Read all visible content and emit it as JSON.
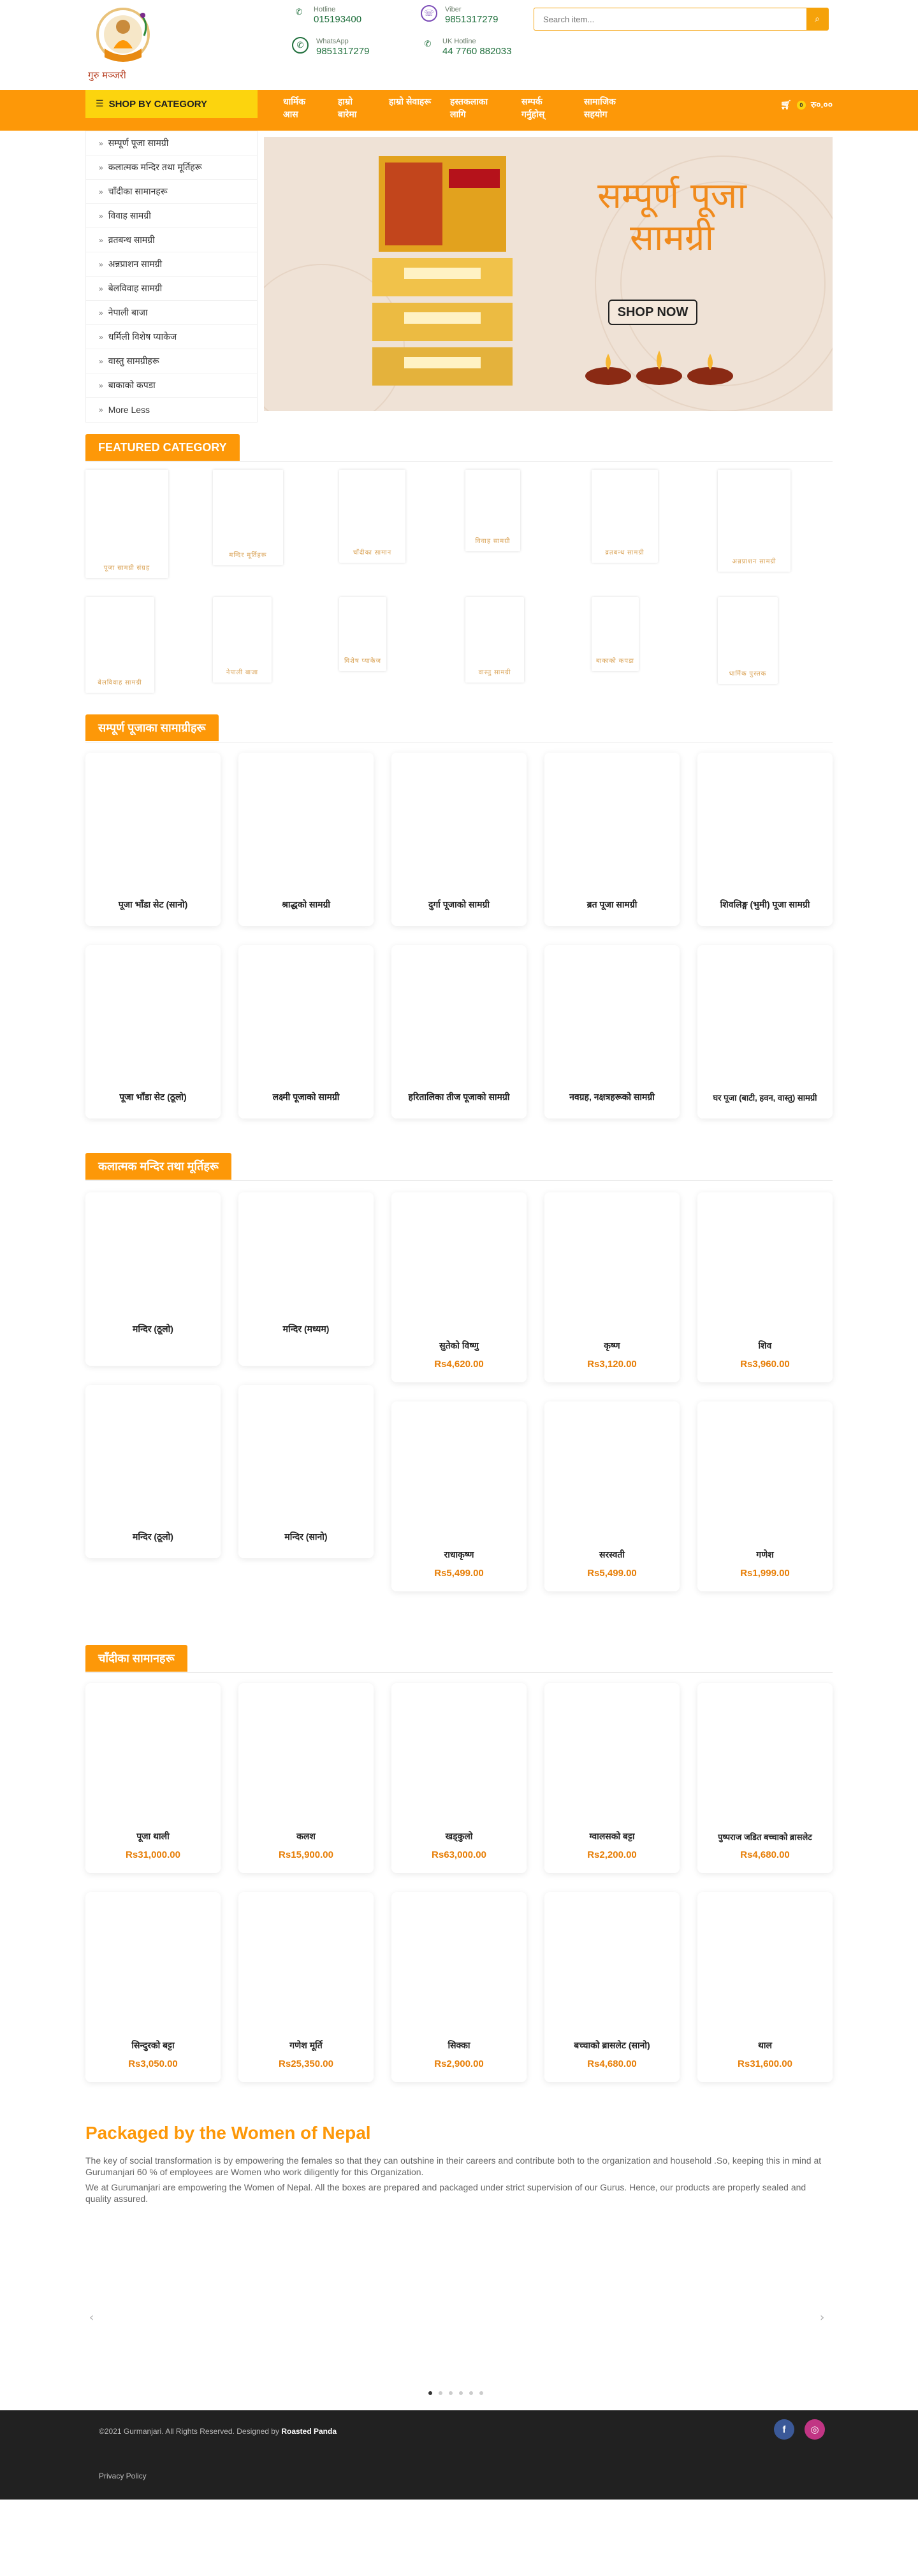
{
  "header": {
    "brand_name": "गुरु मञ्जरी",
    "hotlines": [
      {
        "label": "Hotline",
        "number": "015193400",
        "icon": "phone-icon"
      },
      {
        "label": "Viber",
        "number": "9851317279",
        "icon": "viber-icon"
      },
      {
        "label": "WhatsApp",
        "number": "9851317279",
        "icon": "whatsapp-icon"
      },
      {
        "label": "UK Hotline",
        "number": "44 7760 882033",
        "icon": "phone-icon"
      }
    ],
    "search_placeholder": "Search item..."
  },
  "nav": {
    "category_button": "SHOP BY CATEGORY",
    "items": [
      "धार्मिक आस",
      "हाम्रो बारेमा",
      "हाम्रो सेवाहरू",
      "हस्तकलाका लागि",
      "सम्पर्क गर्नुहोस्",
      "सामाजिक सहयोग"
    ],
    "cart_count": "0",
    "cart_total": "रु०.००"
  },
  "sidebar": {
    "items": [
      "सम्पूर्ण पूजा सामग्री",
      "कलात्मक मन्दिर तथा मूर्तिहरू",
      "चाँदीका सामानहरू",
      "विवाह सामग्री",
      "व्रतबन्ध सामग्री",
      "अन्नप्राशन सामग्री",
      "बेलविवाह सामग्री",
      "नेपाली बाजा",
      "धर्मिली विशेष प्याकेज",
      "वास्तु सामग्रीहरू",
      "बाकाको कपडा",
      "More Less"
    ]
  },
  "banner": {
    "title_line1": "सम्पूर्ण पूजा",
    "title_line2": "सामग्री",
    "shop_button": "SHOP NOW"
  },
  "featured": {
    "heading": "FEATURED CATEGORY",
    "labels": [
      "पूजा सामग्री संग्रह",
      "मन्दिर मूर्तिहरू",
      "चाँदीका सामान",
      "विवाह सामग्री",
      "व्रतबन्ध सामग्री",
      "अन्नप्राशन सामग्री",
      "बेलविवाह सामग्री",
      "नेपाली बाजा",
      "विशेष प्याकेज",
      "वास्तु सामग्री",
      "बाकाको कपडा",
      "धार्मिक पुस्तक"
    ]
  },
  "puja_section": {
    "heading": "सम्पूर्ण पूजाका सामाग्रीहरू",
    "items": [
      "पूजा भाँडा सेट (सानो)",
      "श्राद्धको सामग्री",
      "दुर्गा पूजाको सामग्री",
      "ब्रत पूजा सामग्री",
      "शिवलिङ्ग (भुमी) पूजा सामग्री",
      "पूजा भाँडा सेट (ठूलो)",
      "लक्ष्मी पूजाको सामग्री",
      "हरितालिका तीज पूजाको सामग्री",
      "नवग्रह, नक्षत्रहरूको सामग्री",
      "घर पूजा (बाटी, हवन, वास्तु) सामग्री"
    ]
  },
  "temple_section": {
    "heading": "कलात्मक मन्दिर तथा मूर्तिहरू",
    "items": [
      {
        "name": "मन्दिर (ठूलो)",
        "price": ""
      },
      {
        "name": "मन्दिर (मध्यम)",
        "price": ""
      },
      {
        "name": "सुतेको विष्णु",
        "price": "Rs4,620.00"
      },
      {
        "name": "कृष्ण",
        "price": "Rs3,120.00"
      },
      {
        "name": "शिव",
        "price": "Rs3,960.00"
      },
      {
        "name": "मन्दिर (ठूलो)",
        "price": ""
      },
      {
        "name": "मन्दिर (सानो)",
        "price": ""
      },
      {
        "name": "राधाकृष्ण",
        "price": "Rs5,499.00"
      },
      {
        "name": "सरस्वती",
        "price": "Rs5,499.00"
      },
      {
        "name": "गणेश",
        "price": "Rs1,999.00"
      }
    ]
  },
  "silver_section": {
    "heading": "चाँदीका सामानहरू",
    "items": [
      {
        "name": "पूजा थाली",
        "price": "Rs31,000.00"
      },
      {
        "name": "कलश",
        "price": "Rs15,900.00"
      },
      {
        "name": "खड्कुलो",
        "price": "Rs63,000.00"
      },
      {
        "name": "ग्वालसको बट्टा",
        "price": "Rs2,200.00"
      },
      {
        "name": "पुष्पराज जडित बच्चाको ब्रासलेट",
        "price": "Rs4,680.00"
      },
      {
        "name": "सिन्दुरको बट्टा",
        "price": "Rs3,050.00"
      },
      {
        "name": "गणेश मूर्ति",
        "price": "Rs25,350.00"
      },
      {
        "name": "सिक्का",
        "price": "Rs2,900.00"
      },
      {
        "name": "बच्चाको ब्रासलेट (सानो)",
        "price": "Rs4,680.00"
      },
      {
        "name": "थाल",
        "price": "Rs31,600.00"
      }
    ]
  },
  "about": {
    "title": "Packaged by the Women of Nepal",
    "para1": "The key of social transformation is by empowering the females so that they can outshine in their careers and contribute both to the organization and household .So, keeping this in mind at Gurumanjari  60 % of employees are Women who work diligently for this Organization.",
    "para2": "We at Gurumanjari are empowering the Women of Nepal. All the boxes are prepared and packaged under strict supervision of our Gurus.  Hence, our products are properly  sealed and  quality assured."
  },
  "footer": {
    "copyright": "©2021 Gurmanjari. All Rights Reserved. Designed by",
    "designer": "Roasted Panda",
    "policy": "Privacy Policy",
    "social": [
      "facebook-icon",
      "instagram-icon"
    ]
  },
  "colors": {
    "accent": "#fd9808",
    "category_yellow": "#fcd40e",
    "price": "#e77e06",
    "footer_bg": "#212121"
  }
}
